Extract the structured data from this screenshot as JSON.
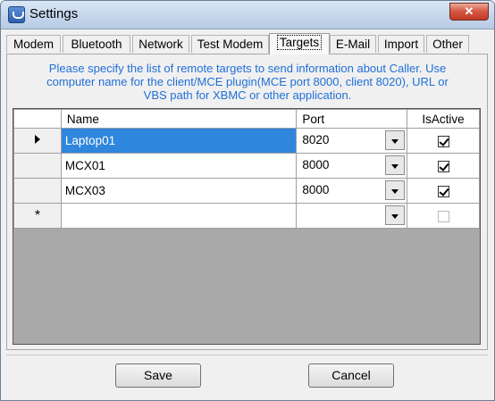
{
  "window": {
    "title": "Settings",
    "close_label": "✕",
    "app_icon": "phone-icon"
  },
  "tabs": [
    {
      "label": "Modem"
    },
    {
      "label": "Bluetooth"
    },
    {
      "label": "Network"
    },
    {
      "label": "Test Modem"
    },
    {
      "label": "Targets",
      "active": true
    },
    {
      "label": "E-Mail"
    },
    {
      "label": "Import"
    },
    {
      "label": "Other"
    }
  ],
  "info_text": "Please specify the list of remote targets to send information about Caller. Use computer name for the client/MCE plugin(MCE port 8000, client 8020), URL or VBS path for XBMC or other application.",
  "grid": {
    "columns": [
      "Name",
      "Port",
      "IsActive"
    ],
    "rows": [
      {
        "name": "Laptop01",
        "port": "8020",
        "active": true,
        "current": true
      },
      {
        "name": "MCX01",
        "port": "8000",
        "active": true
      },
      {
        "name": "MCX03",
        "port": "8000",
        "active": true
      }
    ],
    "new_row_marker": "*"
  },
  "buttons": {
    "save": "Save",
    "cancel": "Cancel"
  },
  "colors": {
    "accent_text": "#1f6fd6",
    "selection": "#2f86dd",
    "empty_grid": "#a9a9a9"
  }
}
